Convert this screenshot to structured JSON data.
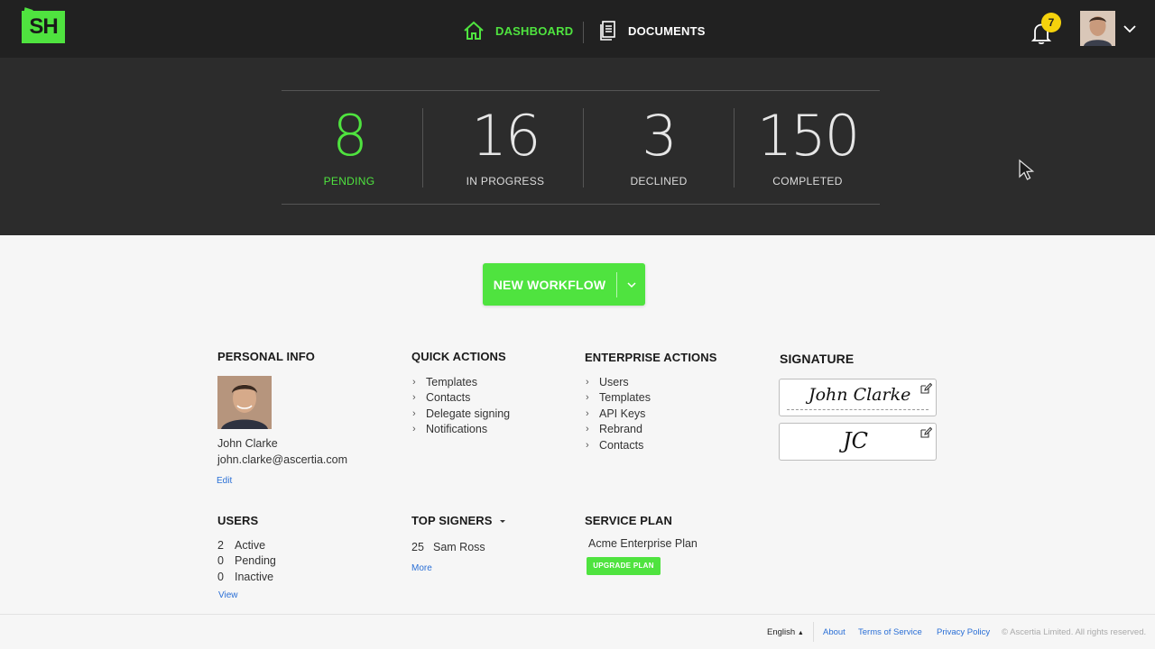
{
  "app": {
    "logo_text": "SH"
  },
  "nav": {
    "dashboard_label": "DASHBOARD",
    "documents_label": "DOCUMENTS",
    "notification_count": "7"
  },
  "stats": [
    {
      "value": "8",
      "label": "PENDING"
    },
    {
      "value": "16",
      "label": "IN PROGRESS"
    },
    {
      "value": "3",
      "label": "DECLINED"
    },
    {
      "value": "150",
      "label": "COMPLETED"
    }
  ],
  "workflow": {
    "label": "NEW WORKFLOW"
  },
  "personal_info": {
    "title": "PERSONAL INFO",
    "name": "John Clarke",
    "email": "john.clarke@ascertia.com",
    "edit_label": "Edit"
  },
  "quick_actions": {
    "title": "QUICK ACTIONS",
    "items": [
      "Templates",
      "Contacts",
      "Delegate signing",
      "Notifications"
    ]
  },
  "enterprise_actions": {
    "title": "ENTERPRISE ACTIONS",
    "items": [
      "Users",
      "Templates",
      "API Keys",
      "Rebrand",
      "Contacts"
    ]
  },
  "signature": {
    "title": "SIGNATURE",
    "full": "John Clarke",
    "initials": "JC"
  },
  "users": {
    "title": "USERS",
    "rows": [
      {
        "count": "2",
        "label": "Active"
      },
      {
        "count": "0",
        "label": "Pending"
      },
      {
        "count": "0",
        "label": "Inactive"
      }
    ],
    "view_label": "View"
  },
  "top_signers": {
    "title": "TOP SIGNERS",
    "rows": [
      {
        "count": "25",
        "name": "Sam Ross"
      }
    ],
    "more_label": "More"
  },
  "service_plan": {
    "title": "SERVICE PLAN",
    "plan_name": "Acme Enterprise Plan",
    "upgrade_label": "UPGRADE PLAN"
  },
  "footer": {
    "language": "English",
    "about": "About",
    "terms": "Terms of Service",
    "privacy": "Privacy Policy",
    "copyright": "© Ascertia Limited. All rights reserved."
  },
  "colors": {
    "accent": "#4fe33f",
    "topbar": "#212121",
    "stats_band": "#2c2c2c",
    "badge": "#f5d20c",
    "link": "#2a6fd6"
  }
}
